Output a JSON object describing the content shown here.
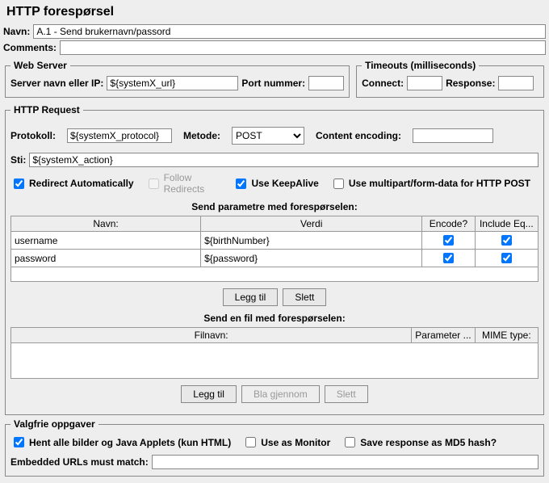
{
  "title": "HTTP forespørsel",
  "name": {
    "label": "Navn:",
    "value": "A.1 - Send brukernavn/passord"
  },
  "comments": {
    "label": "Comments:",
    "value": ""
  },
  "webServer": {
    "legend": "Web Server",
    "serverLabel": "Server navn eller IP:",
    "serverValue": "${systemX_url}",
    "portLabel": "Port nummer:",
    "portValue": ""
  },
  "timeouts": {
    "legend": "Timeouts (milliseconds)",
    "connectLabel": "Connect:",
    "connectValue": "",
    "responseLabel": "Response:",
    "responseValue": ""
  },
  "httpRequest": {
    "legend": "HTTP Request",
    "protocolLabel": "Protokoll:",
    "protocolValue": "${systemX_protocol}",
    "methodLabel": "Metode:",
    "methodValue": "POST",
    "contentEncodingLabel": "Content encoding:",
    "contentEncodingValue": "",
    "pathLabel": "Sti:",
    "pathValue": "${systemX_action}",
    "redirectAuto": "Redirect Automatically",
    "followRedirects": "Follow Redirects",
    "useKeepAlive": "Use KeepAlive",
    "useMultipart": "Use multipart/form-data for HTTP POST",
    "paramsTitle": "Send parametre med forespørselen:",
    "paramsHeaders": {
      "name": "Navn:",
      "value": "Verdi",
      "encode": "Encode?",
      "include": "Include Eq..."
    },
    "params": [
      {
        "name": "username",
        "value": "${birthNumber}",
        "encode": true,
        "include": true
      },
      {
        "name": "password",
        "value": "${password}",
        "encode": true,
        "include": true
      }
    ],
    "addBtn": "Legg til",
    "deleteBtn": "Slett",
    "filesTitle": "Send en fil med forespørselen:",
    "filesHeaders": {
      "filename": "Filnavn:",
      "param": "Parameter ...",
      "mime": "MIME type:"
    },
    "fileAddBtn": "Legg til",
    "browseBtn": "Bla gjennom",
    "fileDeleteBtn": "Slett"
  },
  "optional": {
    "legend": "Valgfrie oppgaver",
    "retrieveImages": "Hent alle bilder og Java Applets (kun HTML)",
    "useAsMonitor": "Use as Monitor",
    "saveMd5": "Save response as MD5 hash?",
    "embeddedLabel": "Embedded URLs must match:",
    "embeddedValue": ""
  }
}
